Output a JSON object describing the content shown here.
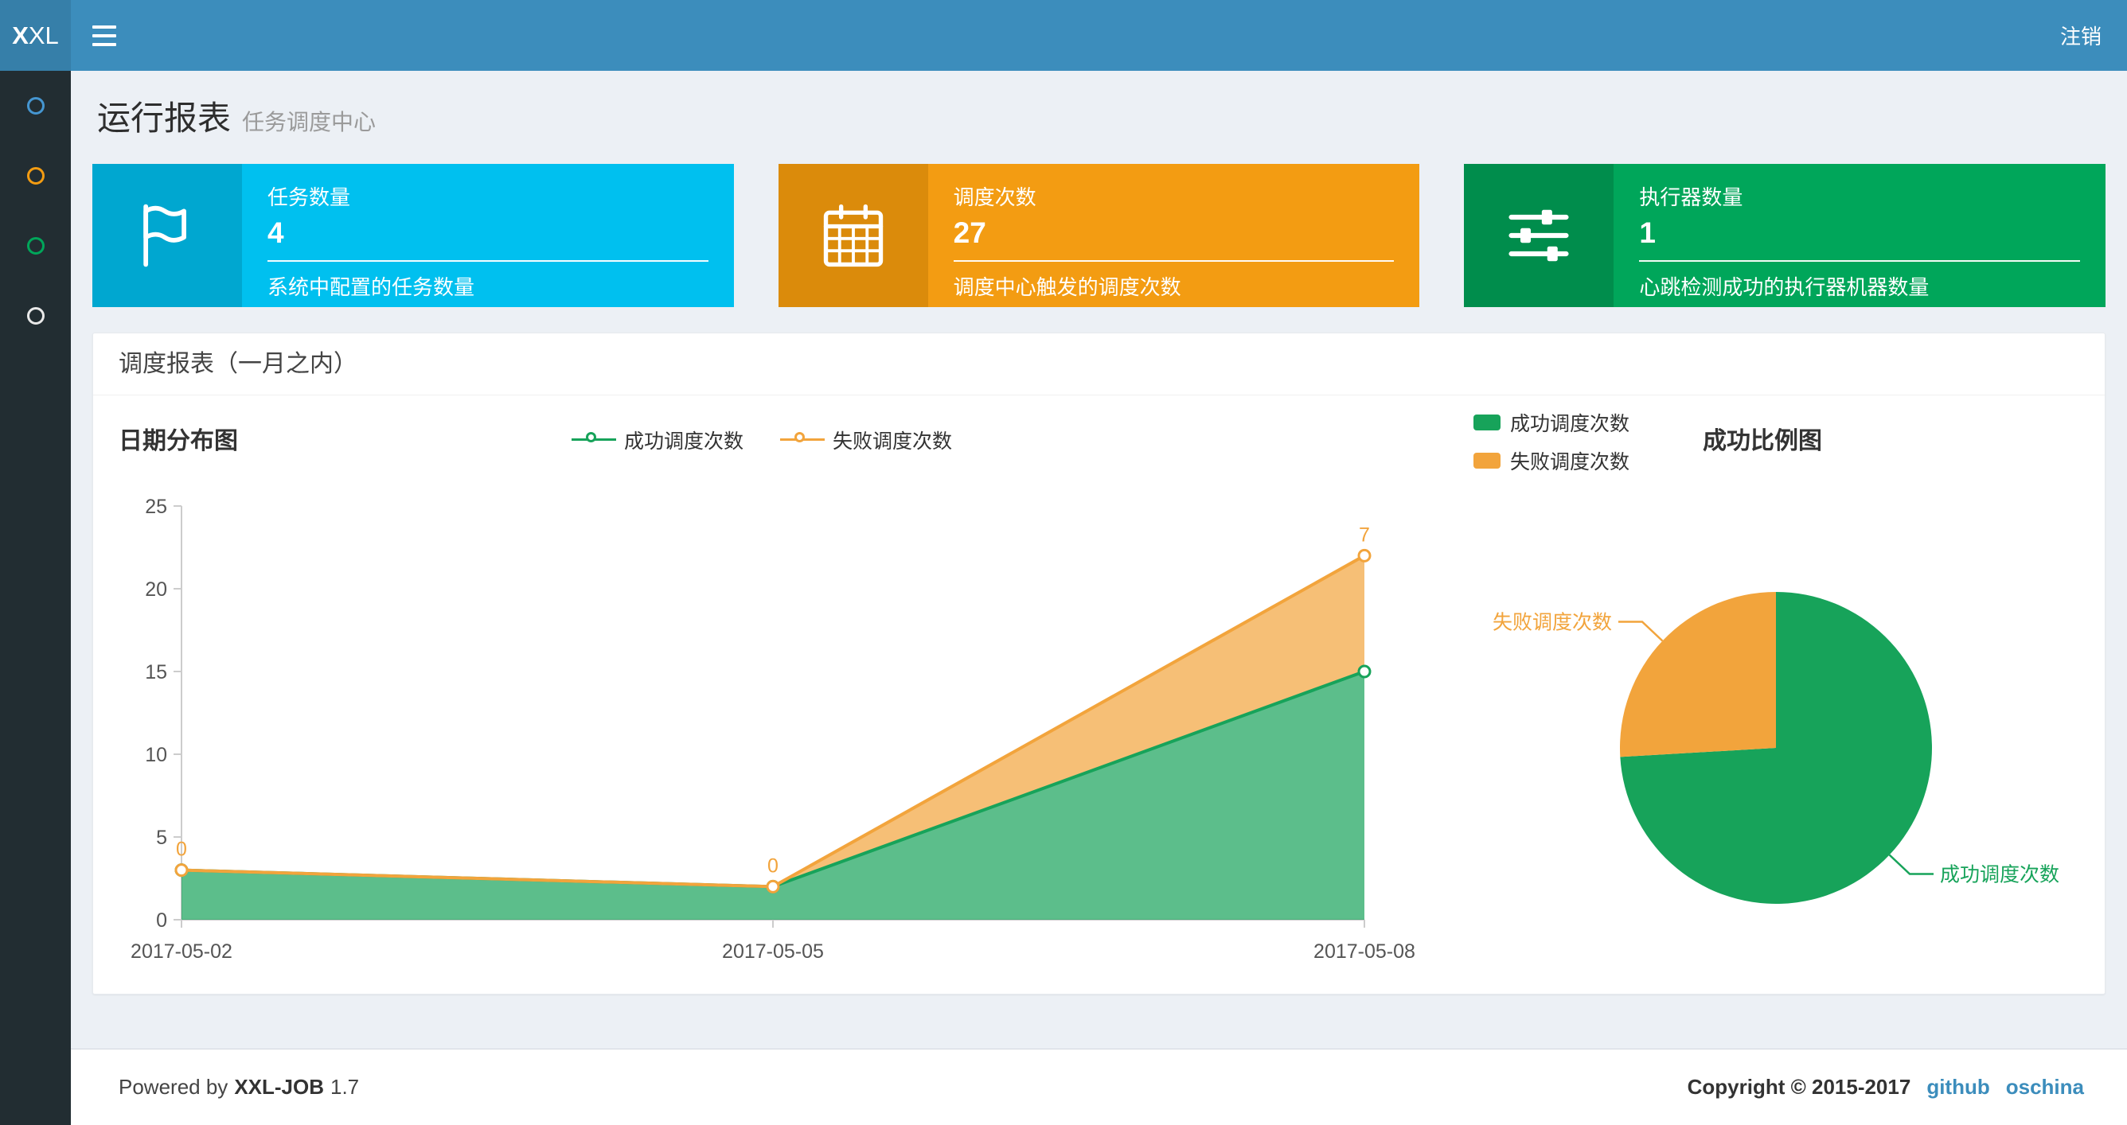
{
  "navbar": {
    "logo_bold": "X",
    "logo_rest": "XL",
    "logout_label": "注销"
  },
  "sidebar": {
    "items": [
      {
        "icon": "circle-icon",
        "color": "#4596d1"
      },
      {
        "icon": "circle-icon",
        "color": "#f39c12"
      },
      {
        "icon": "circle-icon",
        "color": "#00a65a"
      },
      {
        "icon": "circle-icon",
        "color": "#e9e9e9"
      }
    ]
  },
  "page": {
    "title": "运行报表",
    "subtitle": "任务调度中心"
  },
  "info_boxes": [
    {
      "title": "任务数量",
      "value": "4",
      "desc": "系统中配置的任务数量",
      "bg": "#00c0ef",
      "icon_bg": "#00a7d0",
      "icon": "flag-icon"
    },
    {
      "title": "调度次数",
      "value": "27",
      "desc": "调度中心触发的调度次数",
      "bg": "#f39c12",
      "icon_bg": "#db8b0b",
      "icon": "calendar-icon"
    },
    {
      "title": "执行器数量",
      "value": "1",
      "desc": "心跳检测成功的执行器机器数量",
      "bg": "#00a65a",
      "icon_bg": "#008d4c",
      "icon": "sliders-icon"
    }
  ],
  "panel": {
    "title": "调度报表（一月之内）"
  },
  "chart_data": [
    {
      "type": "area",
      "title": "日期分布图",
      "stacked": true,
      "grid": false,
      "legend_position": "top-center",
      "categories": [
        "2017-05-02",
        "2017-05-05",
        "2017-05-08"
      ],
      "series": [
        {
          "name": "成功调度次数",
          "color": "#17a35a",
          "values": [
            3,
            2,
            15
          ]
        },
        {
          "name": "失败调度次数",
          "color": "#f2a43c",
          "values": [
            0,
            0,
            7
          ],
          "labels": [
            "0",
            "0",
            "7"
          ]
        }
      ],
      "xlabel": "",
      "ylabel": "",
      "ylim": [
        0,
        25
      ],
      "yticks": [
        0,
        5,
        10,
        15,
        20,
        25
      ]
    },
    {
      "type": "pie",
      "title": "成功比例图",
      "legend_position": "top-left",
      "slices": [
        {
          "name": "成功调度次数",
          "value": 20,
          "color": "#17a35a"
        },
        {
          "name": "失败调度次数",
          "value": 7,
          "color": "#f2a43c"
        }
      ]
    }
  ],
  "footer": {
    "powered_prefix": "Powered by",
    "product": "XXL-JOB",
    "version": "1.7",
    "copyright": "Copyright © 2015-2017",
    "links": [
      "github",
      "oschina"
    ]
  }
}
